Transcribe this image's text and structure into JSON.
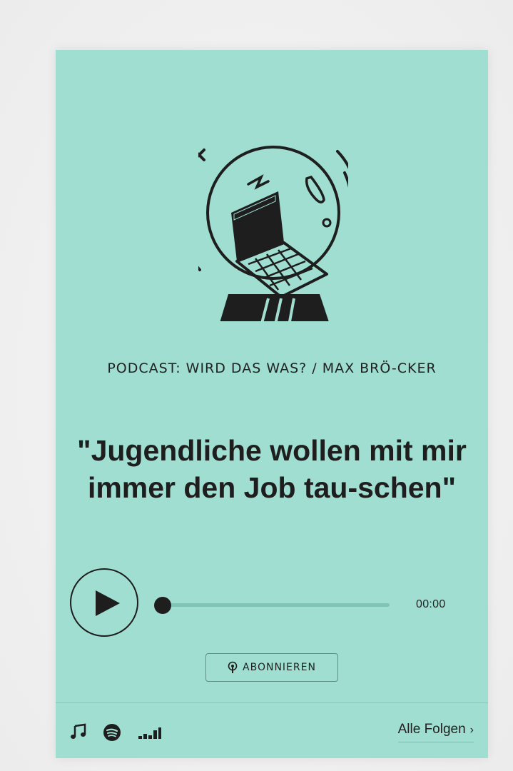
{
  "podcast": {
    "kicker": "PODCAST: WIRD DAS WAS? / MAX BRÖ-CKER",
    "title": "\"Jugendliche wollen mit mir immer den Job tau-schen\""
  },
  "player": {
    "time": "00:00",
    "progress": 0
  },
  "subscribe": {
    "label": "ABONNIEREN",
    "icon": "podcast-icon"
  },
  "footer": {
    "services": [
      {
        "name": "music-note-icon"
      },
      {
        "name": "spotify-icon"
      },
      {
        "name": "deezer-icon"
      }
    ],
    "all_episodes_label": "Alle Folgen",
    "chevron": "›"
  },
  "colors": {
    "card_background": "#9fded0",
    "ink": "#1e1e1e"
  }
}
